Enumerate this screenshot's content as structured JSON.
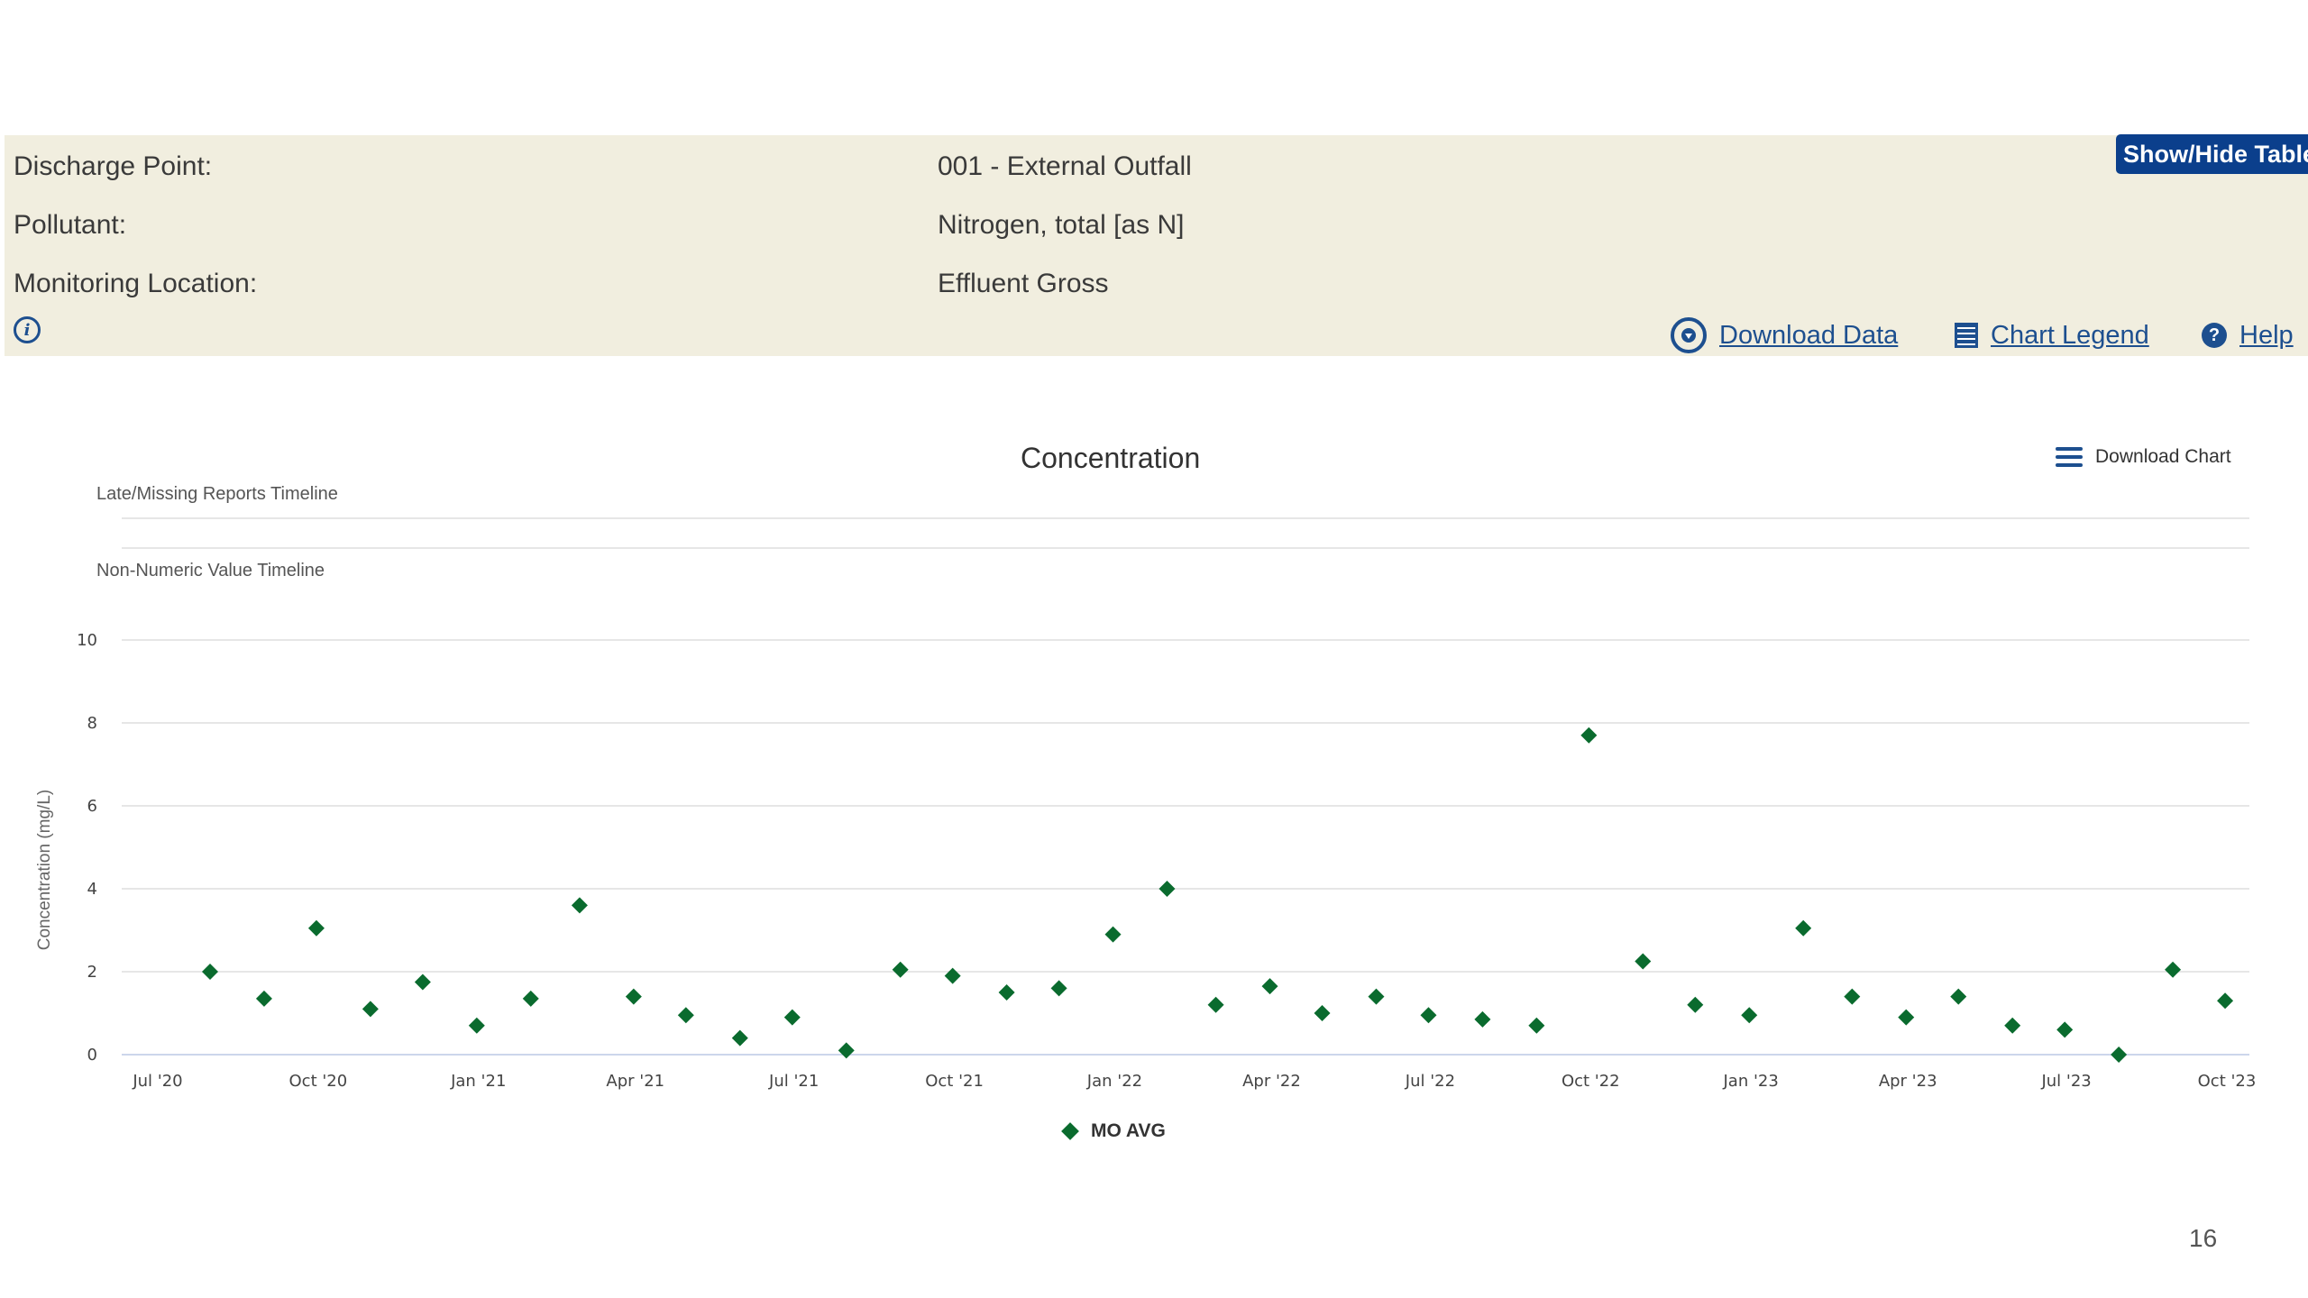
{
  "panel": {
    "rows": [
      {
        "label": "Discharge Point:",
        "value": "001 - External Outfall"
      },
      {
        "label": "Pollutant:",
        "value": "Nitrogen, total [as N]"
      },
      {
        "label": "Monitoring Location:",
        "value": "Effluent Gross"
      }
    ],
    "show_hide_label": "Show/Hide Table",
    "info_icon_glyph": "i",
    "links": {
      "download_data": "Download Data",
      "chart_legend": "Chart Legend",
      "help": "Help",
      "help_glyph": "?"
    },
    "colors": {
      "panel_bg": "#f1eedf",
      "accent": "#1d4f8f",
      "button_bg": "#0b3f8c"
    }
  },
  "chart_toolbar": {
    "download_chart_label": "Download Chart"
  },
  "timelines": {
    "late_missing": "Late/Missing Reports Timeline",
    "non_numeric": "Non-Numeric Value Timeline"
  },
  "page_number": "16",
  "chart_data": {
    "type": "scatter",
    "title": "Concentration",
    "xlabel": "",
    "ylabel": "Concentration (mg/L)",
    "ylim": [
      0,
      10
    ],
    "yticks": [
      0,
      2,
      4,
      6,
      8,
      10
    ],
    "xlim": [
      "2020-07-01",
      "2023-10-01"
    ],
    "xticks": [
      {
        "date": "2020-07-01",
        "label": "Jul '20"
      },
      {
        "date": "2020-10-01",
        "label": "Oct '20"
      },
      {
        "date": "2021-01-01",
        "label": "Jan '21"
      },
      {
        "date": "2021-04-01",
        "label": "Apr '21"
      },
      {
        "date": "2021-07-01",
        "label": "Jul '21"
      },
      {
        "date": "2021-10-01",
        "label": "Oct '21"
      },
      {
        "date": "2022-01-01",
        "label": "Jan '22"
      },
      {
        "date": "2022-04-01",
        "label": "Apr '22"
      },
      {
        "date": "2022-07-01",
        "label": "Jul '22"
      },
      {
        "date": "2022-10-01",
        "label": "Oct '22"
      },
      {
        "date": "2023-01-01",
        "label": "Jan '23"
      },
      {
        "date": "2023-04-01",
        "label": "Apr '23"
      },
      {
        "date": "2023-07-01",
        "label": "Jul '23"
      },
      {
        "date": "2023-10-01",
        "label": "Oct '23"
      }
    ],
    "grid": true,
    "legend_position": "bottom-center",
    "series": [
      {
        "name": "MO AVG",
        "color": "#0a6b2e",
        "marker": "diamond",
        "points": [
          {
            "x": "2020-07-31",
            "y": 2.0
          },
          {
            "x": "2020-08-31",
            "y": 1.35
          },
          {
            "x": "2020-09-30",
            "y": 3.05
          },
          {
            "x": "2020-10-31",
            "y": 1.1
          },
          {
            "x": "2020-11-30",
            "y": 1.75
          },
          {
            "x": "2020-12-31",
            "y": 0.7
          },
          {
            "x": "2021-01-31",
            "y": 1.35
          },
          {
            "x": "2021-02-28",
            "y": 3.6
          },
          {
            "x": "2021-03-31",
            "y": 1.4
          },
          {
            "x": "2021-04-30",
            "y": 0.95
          },
          {
            "x": "2021-05-31",
            "y": 0.4
          },
          {
            "x": "2021-06-30",
            "y": 0.9
          },
          {
            "x": "2021-07-31",
            "y": 0.1
          },
          {
            "x": "2021-08-31",
            "y": 2.05
          },
          {
            "x": "2021-09-30",
            "y": 1.9
          },
          {
            "x": "2021-10-31",
            "y": 1.5
          },
          {
            "x": "2021-11-30",
            "y": 1.6
          },
          {
            "x": "2021-12-31",
            "y": 2.9
          },
          {
            "x": "2022-01-31",
            "y": 4.0
          },
          {
            "x": "2022-02-28",
            "y": 1.2
          },
          {
            "x": "2022-03-31",
            "y": 1.65
          },
          {
            "x": "2022-04-30",
            "y": 1.0
          },
          {
            "x": "2022-05-31",
            "y": 1.4
          },
          {
            "x": "2022-06-30",
            "y": 0.95
          },
          {
            "x": "2022-07-31",
            "y": 0.85
          },
          {
            "x": "2022-08-31",
            "y": 0.7
          },
          {
            "x": "2022-09-30",
            "y": 7.7
          },
          {
            "x": "2022-10-31",
            "y": 2.25
          },
          {
            "x": "2022-11-30",
            "y": 1.2
          },
          {
            "x": "2022-12-31",
            "y": 0.95
          },
          {
            "x": "2023-01-31",
            "y": 3.05
          },
          {
            "x": "2023-02-28",
            "y": 1.4
          },
          {
            "x": "2023-03-31",
            "y": 0.9
          },
          {
            "x": "2023-04-30",
            "y": 1.4
          },
          {
            "x": "2023-05-31",
            "y": 0.7
          },
          {
            "x": "2023-06-30",
            "y": 0.6
          },
          {
            "x": "2023-07-31",
            "y": 0.0
          },
          {
            "x": "2023-08-31",
            "y": 2.05
          },
          {
            "x": "2023-09-30",
            "y": 1.3
          }
        ]
      }
    ]
  }
}
